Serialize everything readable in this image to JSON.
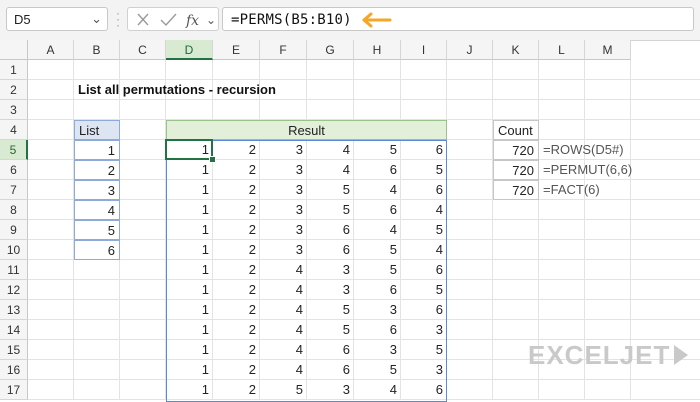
{
  "namebox": {
    "value": "D5"
  },
  "formula_bar": {
    "formula": "=PERMS(B5:B10)"
  },
  "columns": [
    "A",
    "B",
    "C",
    "D",
    "E",
    "F",
    "G",
    "H",
    "I",
    "J",
    "K",
    "L",
    "M"
  ],
  "rows": [
    "1",
    "2",
    "3",
    "4",
    "5",
    "6",
    "7",
    "8",
    "9",
    "10",
    "11",
    "12",
    "13",
    "14",
    "15",
    "16",
    "17"
  ],
  "sheet": {
    "title": "List all permutations - recursion",
    "list_header": "List",
    "list_values": [
      "1",
      "2",
      "3",
      "4",
      "5",
      "6"
    ],
    "result_header": "Result",
    "result_rows": [
      [
        "1",
        "2",
        "3",
        "4",
        "5",
        "6"
      ],
      [
        "1",
        "2",
        "3",
        "4",
        "6",
        "5"
      ],
      [
        "1",
        "2",
        "3",
        "5",
        "4",
        "6"
      ],
      [
        "1",
        "2",
        "3",
        "5",
        "6",
        "4"
      ],
      [
        "1",
        "2",
        "3",
        "6",
        "4",
        "5"
      ],
      [
        "1",
        "2",
        "3",
        "6",
        "5",
        "4"
      ],
      [
        "1",
        "2",
        "4",
        "3",
        "5",
        "6"
      ],
      [
        "1",
        "2",
        "4",
        "3",
        "6",
        "5"
      ],
      [
        "1",
        "2",
        "4",
        "5",
        "3",
        "6"
      ],
      [
        "1",
        "2",
        "4",
        "5",
        "6",
        "3"
      ],
      [
        "1",
        "2",
        "4",
        "6",
        "3",
        "5"
      ],
      [
        "1",
        "2",
        "4",
        "6",
        "5",
        "3"
      ],
      [
        "1",
        "2",
        "5",
        "3",
        "4",
        "6"
      ]
    ],
    "count_header": "Count",
    "count_values": [
      "720",
      "720",
      "720"
    ],
    "count_notes": [
      "=ROWS(D5#)",
      "=PERMUT(6,6)",
      "=FACT(6)"
    ]
  },
  "logo": {
    "text": "EXCELJET"
  },
  "colors": {
    "selection": "#217346",
    "spill": "#5b8ad8",
    "list_header_fill": "#dde5f3",
    "result_header_fill": "#e2efd9",
    "arrow": "#f5a623"
  }
}
